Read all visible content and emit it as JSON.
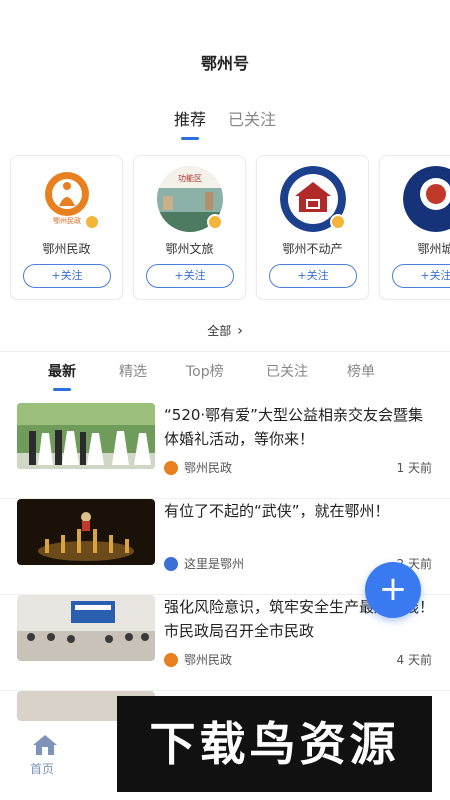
{
  "header": {
    "title": "鄂州号"
  },
  "top_tabs": [
    {
      "label": "推荐",
      "active": true
    },
    {
      "label": "已关注",
      "active": false
    }
  ],
  "accounts": [
    {
      "name": "鄂州民政",
      "follow_label": "+关注",
      "logo": "civil-affairs-logo"
    },
    {
      "name": "鄂州文旅",
      "follow_label": "+关注",
      "logo": "culture-tourism-logo"
    },
    {
      "name": "鄂州不动产",
      "follow_label": "+关注",
      "logo": "real-estate-logo"
    },
    {
      "name": "鄂州城",
      "follow_label": "+关注",
      "logo": "city-logo"
    }
  ],
  "all_link": {
    "label": "全部",
    "icon": "chevron-right-icon"
  },
  "sub_tabs": [
    {
      "label": "最新",
      "active": true
    },
    {
      "label": "精选",
      "active": false
    },
    {
      "label": "Top榜",
      "active": false
    },
    {
      "label": "已关注",
      "active": false
    },
    {
      "label": "榜单",
      "active": false
    }
  ],
  "news": [
    {
      "title": "“520·鄂有爱”大型公益相亲交友会暨集体婚礼活动，等你来！",
      "source": "鄂州民政",
      "time": "1 天前"
    },
    {
      "title": "有位了不起的“武侠”，就在鄂州！",
      "source": "这里是鄂州",
      "time": "2 天前"
    },
    {
      "title": "强化风险意识，筑牢安全生产最严防线！市民政局召开全市民政",
      "source": "鄂州民政",
      "time": "4 天前"
    }
  ],
  "fab": {
    "label": "+"
  },
  "bottom_nav": {
    "home_label": "首页",
    "icon": "home-icon"
  },
  "watermark": {
    "text": "下载鸟资源"
  },
  "colors": {
    "accent": "#2d6fe0",
    "fab": "#3a7af0",
    "badge": "#f3b53a"
  }
}
